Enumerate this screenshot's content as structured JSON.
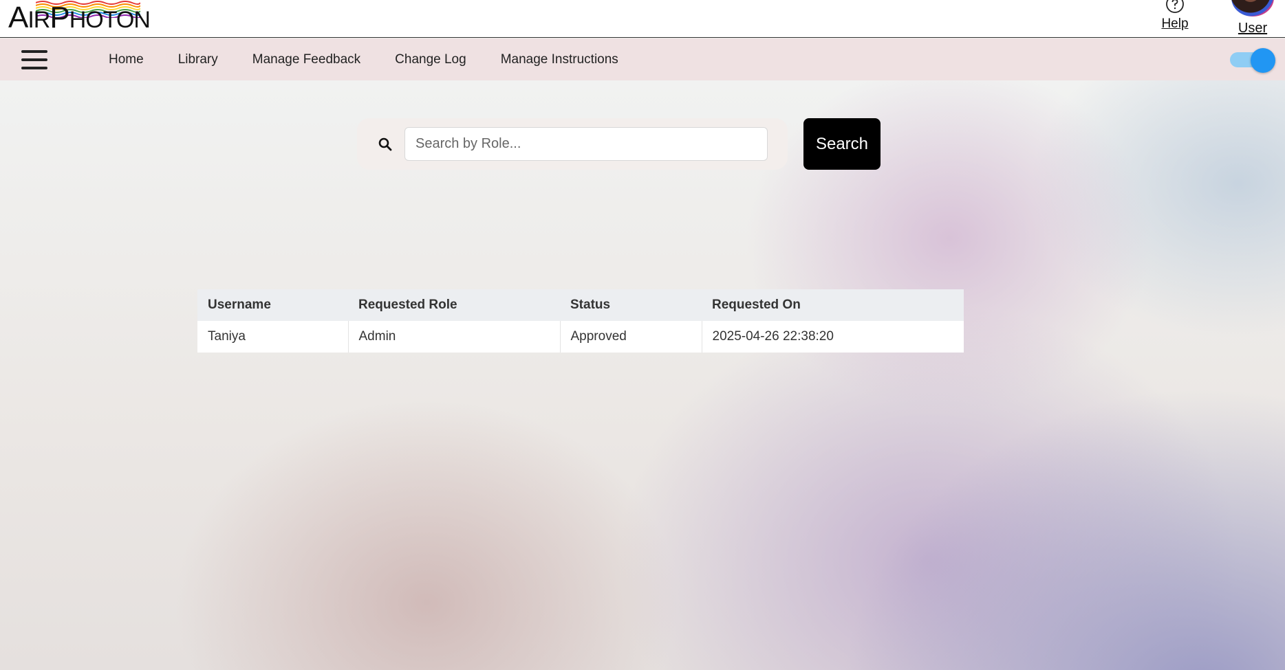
{
  "header": {
    "logo_text_big1": "A",
    "logo_text_small1": "IR",
    "logo_text_big2": "P",
    "logo_text_small2": "HOTON",
    "help_label": "Help",
    "user_label": "User"
  },
  "nav": {
    "items": [
      {
        "label": "Home"
      },
      {
        "label": "Library"
      },
      {
        "label": "Manage Feedback"
      },
      {
        "label": "Change Log"
      },
      {
        "label": "Manage Instructions"
      }
    ],
    "theme_toggle_on": true
  },
  "search": {
    "placeholder": "Search by Role...",
    "value": "",
    "button_label": "Search"
  },
  "table": {
    "headers": [
      "Username",
      "Requested Role",
      "Status",
      "Requested On"
    ],
    "rows": [
      [
        "Taniya",
        "Admin",
        "Approved",
        "2025-04-26 22:38:20"
      ]
    ]
  },
  "colors": {
    "nav_bg": "#efe1e2",
    "toggle_accent": "#2196f3",
    "search_button_bg": "#000000",
    "table_header_bg": "#eceef1"
  }
}
